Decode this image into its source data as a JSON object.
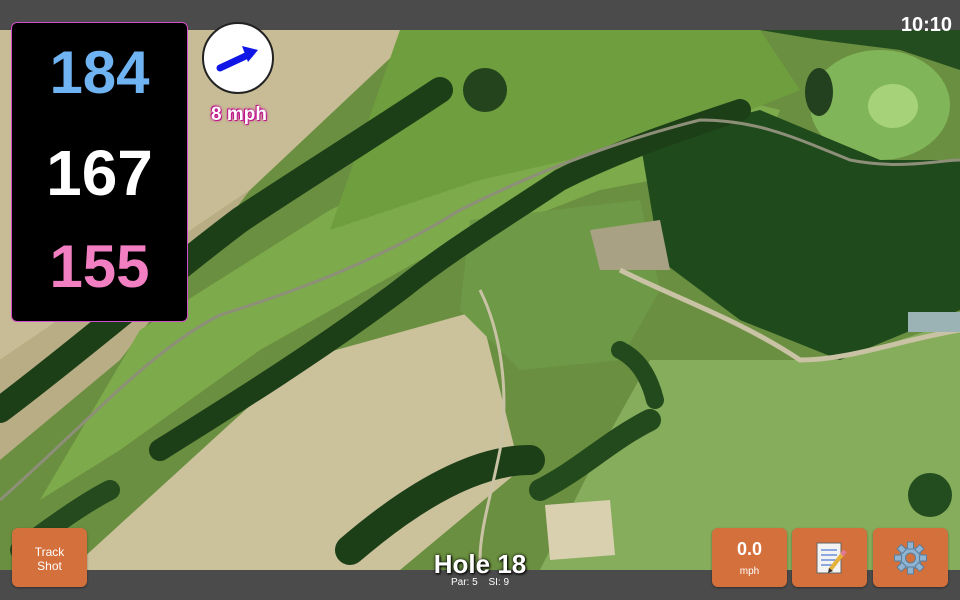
{
  "clock": {
    "time": "10:10"
  },
  "distances": {
    "back": "184",
    "middle": "167",
    "front": "155"
  },
  "wind": {
    "speed_label": "8 mph",
    "arrow_icon": "wind-arrow-icon",
    "arrow_color": "#1016e6"
  },
  "buttons": {
    "track_shot": "Track Shot",
    "speed_value": "0.0",
    "speed_unit": "mph",
    "notes_icon": "notepad-icon",
    "settings_icon": "gear-icon"
  },
  "hole": {
    "title": "Hole 18",
    "par": "Par: 5",
    "si": "SI: 9"
  },
  "colors": {
    "back_distance": "#6fb3f2",
    "middle_distance": "#ffffff",
    "front_distance": "#f27fc2",
    "button_bg": "#d4703c",
    "panel_border": "#d24ec8"
  }
}
